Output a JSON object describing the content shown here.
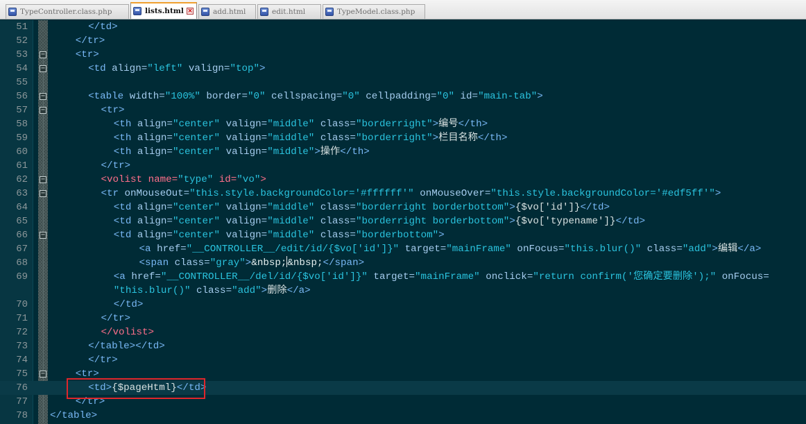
{
  "tabs": [
    {
      "label": "TypeController.class.php",
      "active": false,
      "width": 178
    },
    {
      "label": "lists.html",
      "active": true,
      "width": 96
    },
    {
      "label": "add.html",
      "active": false,
      "width": 83
    },
    {
      "label": "edit.html",
      "active": false,
      "width": 92
    },
    {
      "label": "TypeModel.class.php",
      "active": false,
      "width": 148
    }
  ],
  "colors": {
    "background": "#002b36",
    "tag": "#79b8f5",
    "string": "#2ac3de",
    "var": "#ff6f8a",
    "highlight_border": "#e0262b"
  },
  "icons": {
    "file": "file-icon",
    "close": "close-tab-icon",
    "fold": "fold-toggle-icon"
  },
  "lines": [
    {
      "n": "51",
      "fold": "",
      "indent": 12,
      "t": [
        [
          "tg",
          "</td>"
        ]
      ]
    },
    {
      "n": "52",
      "fold": "",
      "indent": 8,
      "t": [
        [
          "tg",
          "</tr>"
        ]
      ]
    },
    {
      "n": "53",
      "fold": "−",
      "indent": 8,
      "t": [
        [
          "tg",
          "<tr>"
        ]
      ]
    },
    {
      "n": "54",
      "fold": "−",
      "indent": 12,
      "t": [
        [
          "tg",
          "<td "
        ],
        [
          "at",
          "align="
        ],
        [
          "st",
          "\"left\""
        ],
        [
          "at",
          " valign="
        ],
        [
          "st",
          "\"top\""
        ],
        [
          "tg",
          ">"
        ]
      ]
    },
    {
      "n": "55",
      "fold": "",
      "indent": 0,
      "t": []
    },
    {
      "n": "56",
      "fold": "−",
      "indent": 12,
      "t": [
        [
          "tg",
          "<table "
        ],
        [
          "at",
          "width="
        ],
        [
          "st",
          "\"100%\""
        ],
        [
          "at",
          " border="
        ],
        [
          "st",
          "\"0\""
        ],
        [
          "at",
          " cellspacing="
        ],
        [
          "st",
          "\"0\""
        ],
        [
          "at",
          " cellpadding="
        ],
        [
          "st",
          "\"0\""
        ],
        [
          "at",
          " id="
        ],
        [
          "st",
          "\"main-tab\""
        ],
        [
          "tg",
          ">"
        ]
      ]
    },
    {
      "n": "57",
      "fold": "−",
      "indent": 16,
      "t": [
        [
          "tg",
          "<tr>"
        ]
      ]
    },
    {
      "n": "58",
      "fold": "",
      "indent": 20,
      "t": [
        [
          "tg",
          "<th "
        ],
        [
          "at",
          "align="
        ],
        [
          "st",
          "\"center\""
        ],
        [
          "at",
          " valign="
        ],
        [
          "st",
          "\"middle\""
        ],
        [
          "at",
          " class="
        ],
        [
          "st",
          "\"borderright\""
        ],
        [
          "tg",
          ">"
        ],
        [
          "pl",
          "编号"
        ],
        [
          "tg",
          "</th>"
        ]
      ]
    },
    {
      "n": "59",
      "fold": "",
      "indent": 20,
      "t": [
        [
          "tg",
          "<th "
        ],
        [
          "at",
          "align="
        ],
        [
          "st",
          "\"center\""
        ],
        [
          "at",
          " valign="
        ],
        [
          "st",
          "\"middle\""
        ],
        [
          "at",
          " class="
        ],
        [
          "st",
          "\"borderright\""
        ],
        [
          "tg",
          ">"
        ],
        [
          "pl",
          "栏目名称"
        ],
        [
          "tg",
          "</th>"
        ]
      ]
    },
    {
      "n": "60",
      "fold": "",
      "indent": 20,
      "t": [
        [
          "tg",
          "<th "
        ],
        [
          "at",
          "align="
        ],
        [
          "st",
          "\"center\""
        ],
        [
          "at",
          " valign="
        ],
        [
          "st",
          "\"middle\""
        ],
        [
          "tg",
          ">"
        ],
        [
          "pl",
          "操作"
        ],
        [
          "tg",
          "</th>"
        ]
      ]
    },
    {
      "n": "61",
      "fold": "",
      "indent": 16,
      "t": [
        [
          "tg",
          "</tr>"
        ]
      ]
    },
    {
      "n": "62",
      "fold": "−",
      "indent": 16,
      "t": [
        [
          "vt",
          "<volist "
        ],
        [
          "vt",
          "name="
        ],
        [
          "st",
          "\"type\""
        ],
        [
          "vt",
          " id="
        ],
        [
          "st",
          "\"vo\""
        ],
        [
          "vt",
          ">"
        ]
      ]
    },
    {
      "n": "63",
      "fold": "−",
      "indent": 16,
      "t": [
        [
          "tg",
          "<tr "
        ],
        [
          "at",
          "onMouseOut="
        ],
        [
          "st",
          "\"this.style.backgroundColor='#ffffff'\""
        ],
        [
          "at",
          " onMouseOver="
        ],
        [
          "st",
          "\"this.style.backgroundColor='#edf5ff'\""
        ],
        [
          "tg",
          ">"
        ]
      ]
    },
    {
      "n": "64",
      "fold": "",
      "indent": 20,
      "t": [
        [
          "tg",
          "<td "
        ],
        [
          "at",
          "align="
        ],
        [
          "st",
          "\"center\""
        ],
        [
          "at",
          " valign="
        ],
        [
          "st",
          "\"middle\""
        ],
        [
          "at",
          " class="
        ],
        [
          "st",
          "\"borderright borderbottom\""
        ],
        [
          "tg",
          ">"
        ],
        [
          "pl",
          "{$vo['id']}"
        ],
        [
          "tg",
          "</td>"
        ]
      ]
    },
    {
      "n": "65",
      "fold": "",
      "indent": 20,
      "t": [
        [
          "tg",
          "<td "
        ],
        [
          "at",
          "align="
        ],
        [
          "st",
          "\"center\""
        ],
        [
          "at",
          " valign="
        ],
        [
          "st",
          "\"middle\""
        ],
        [
          "at",
          " class="
        ],
        [
          "st",
          "\"borderright borderbottom\""
        ],
        [
          "tg",
          ">"
        ],
        [
          "pl",
          "{$vo['typename']}"
        ],
        [
          "tg",
          "</td>"
        ]
      ]
    },
    {
      "n": "66",
      "fold": "−",
      "indent": 20,
      "t": [
        [
          "tg",
          "<td "
        ],
        [
          "at",
          "align="
        ],
        [
          "st",
          "\"center\""
        ],
        [
          "at",
          " valign="
        ],
        [
          "st",
          "\"middle\""
        ],
        [
          "at",
          " class="
        ],
        [
          "st",
          "\"borderbottom\""
        ],
        [
          "tg",
          ">"
        ]
      ]
    },
    {
      "n": "67",
      "fold": "",
      "indent": 28,
      "t": [
        [
          "tg",
          "<a "
        ],
        [
          "at",
          "href="
        ],
        [
          "st",
          "\"__CONTROLLER__/edit/id/{$vo['id']}\""
        ],
        [
          "at",
          " target="
        ],
        [
          "st",
          "\"mainFrame\""
        ],
        [
          "at",
          " onFocus="
        ],
        [
          "st",
          "\"this.blur()\""
        ],
        [
          "at",
          " class="
        ],
        [
          "st",
          "\"add\""
        ],
        [
          "tg",
          ">"
        ],
        [
          "pl",
          "编辑"
        ],
        [
          "tg",
          "</a>"
        ]
      ]
    },
    {
      "n": "68",
      "fold": "",
      "indent": 28,
      "t": [
        [
          "tg",
          "<span "
        ],
        [
          "at",
          "class="
        ],
        [
          "st",
          "\"gray\""
        ],
        [
          "tg",
          ">"
        ],
        [
          "ent",
          "&nbsp;"
        ],
        [
          "cur",
          ""
        ],
        [
          "ent",
          "&nbsp;"
        ],
        [
          "tg",
          "</span>"
        ]
      ]
    },
    {
      "n": "69",
      "fold": "",
      "indent": 20,
      "t": [
        [
          "tg",
          "<a "
        ],
        [
          "at",
          "href="
        ],
        [
          "st",
          "\"__CONTROLLER__/del/id/{$vo['id']}\""
        ],
        [
          "at",
          " target="
        ],
        [
          "st",
          "\"mainFrame\""
        ],
        [
          "at",
          " onclick="
        ],
        [
          "st",
          "\"return confirm('您确定要删除');\""
        ],
        [
          "at",
          " onFocus="
        ]
      ]
    },
    {
      "n": "",
      "fold": "",
      "indent": 20,
      "t": [
        [
          "st",
          "\"this.blur()\""
        ],
        [
          "at",
          " class="
        ],
        [
          "st",
          "\"add\""
        ],
        [
          "tg",
          ">"
        ],
        [
          "pl",
          "删除"
        ],
        [
          "tg",
          "</a>"
        ]
      ]
    },
    {
      "n": "70",
      "fold": "",
      "indent": 20,
      "t": [
        [
          "tg",
          "</td>"
        ]
      ]
    },
    {
      "n": "71",
      "fold": "",
      "indent": 16,
      "t": [
        [
          "tg",
          "</tr>"
        ]
      ]
    },
    {
      "n": "72",
      "fold": "",
      "indent": 16,
      "t": [
        [
          "vt",
          "</volist>"
        ]
      ]
    },
    {
      "n": "73",
      "fold": "",
      "indent": 12,
      "t": [
        [
          "tg",
          "</table></td>"
        ]
      ]
    },
    {
      "n": "74",
      "fold": "",
      "indent": 12,
      "t": [
        [
          "tg",
          "</tr>"
        ]
      ]
    },
    {
      "n": "75",
      "fold": "−",
      "indent": 8,
      "t": [
        [
          "tg",
          "<tr>"
        ]
      ]
    },
    {
      "n": "76",
      "fold": "",
      "indent": 12,
      "current": true,
      "t": [
        [
          "tg",
          "<td>"
        ],
        [
          "pl",
          "{$pageHtml}"
        ],
        [
          "tg",
          "</td>"
        ]
      ]
    },
    {
      "n": "77",
      "fold": "",
      "indent": 8,
      "t": [
        [
          "tg",
          "</tr>"
        ]
      ]
    },
    {
      "n": "78",
      "fold": "",
      "indent": 0,
      "t": [
        [
          "tg",
          "</table>"
        ]
      ]
    }
  ]
}
